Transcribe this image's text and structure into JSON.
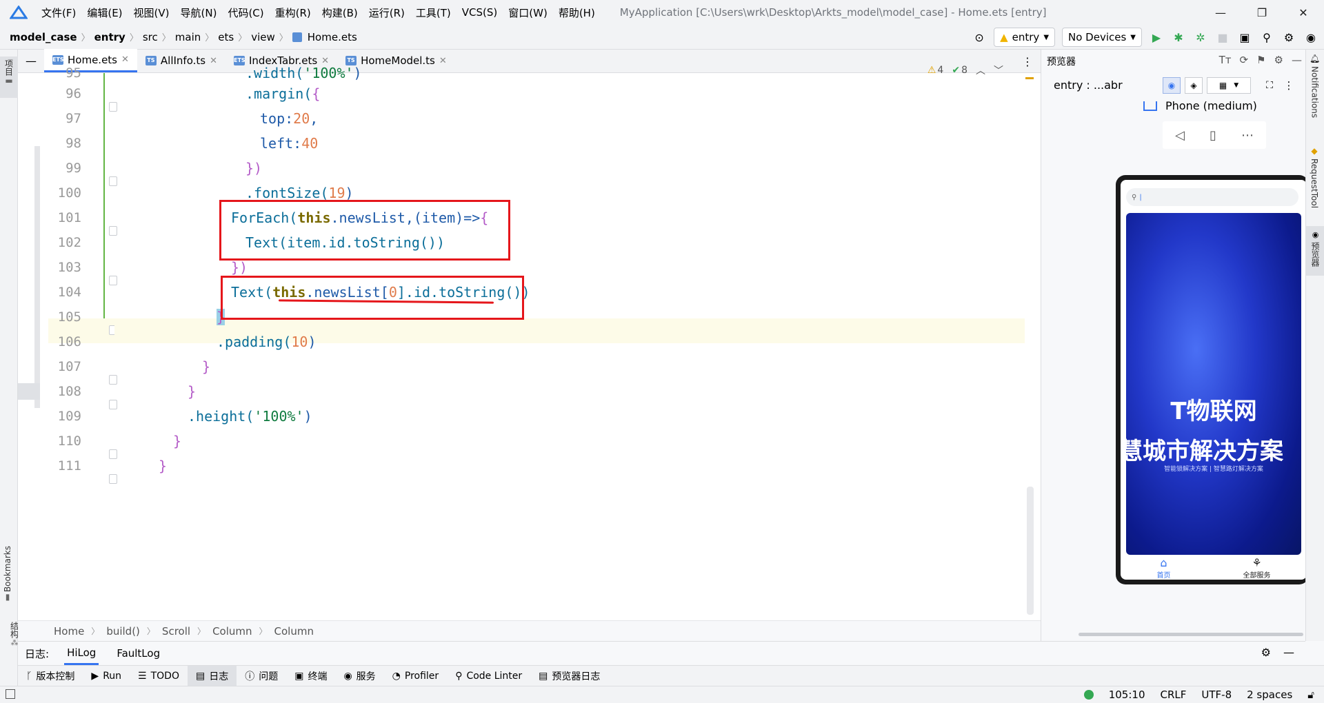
{
  "titlebar": {
    "menus": [
      "文件(F)",
      "编辑(E)",
      "视图(V)",
      "导航(N)",
      "代码(C)",
      "重构(R)",
      "构建(B)",
      "运行(R)",
      "工具(T)",
      "VCS(S)",
      "窗口(W)",
      "帮助(H)"
    ],
    "title": "MyApplication [C:\\Users\\wrk\\Desktop\\Arkts_model\\model_case] - Home.ets [entry]"
  },
  "navbar": {
    "crumbs": [
      "model_case",
      "entry",
      "src",
      "main",
      "ets",
      "view",
      "Home.ets"
    ],
    "module_select": "entry",
    "device_select": "No Devices"
  },
  "leftstrip": {
    "project": "项目",
    "bookmarks": "Bookmarks",
    "structure": "结构"
  },
  "tabs": [
    "Home.ets",
    "AllInfo.ts",
    "IndexTabr.ets",
    "HomeModel.ts"
  ],
  "editor": {
    "line_numbers": [
      "95",
      "96",
      "97",
      "98",
      "99",
      "100",
      "101",
      "102",
      "103",
      "104",
      "105",
      "106",
      "107",
      "108",
      "109",
      "110",
      "111"
    ],
    "warnings": "4",
    "checks": "8",
    "breadcrumb": [
      "Home",
      "build()",
      "Scroll",
      "Column",
      "Column"
    ]
  },
  "code": {
    "l95": [
      ".width(",
      "'100%'",
      ")"
    ],
    "l96": [
      ".margin(",
      "{"
    ],
    "l97": [
      "top:",
      "20",
      ","
    ],
    "l98": [
      "left:",
      "40"
    ],
    "l99": [
      "})"
    ],
    "l100": [
      ".fontSize(",
      "19",
      ")"
    ],
    "l101": [
      "ForEach(",
      "this",
      ".newsList,(item)=>",
      "{"
    ],
    "l102": [
      "Text(item.id.toString())"
    ],
    "l103": [
      "})"
    ],
    "l104": [
      "Text(",
      "this",
      ".newsList[",
      "0",
      "].id.toString())"
    ],
    "l105": [
      "}"
    ],
    "l106": [
      ".padding(",
      "10",
      ")"
    ],
    "l107": [
      "}"
    ],
    "l108": [
      "}"
    ],
    "l109": [
      ".height(",
      "'100%'",
      ")"
    ],
    "l110": [
      "}"
    ],
    "l111": [
      "}"
    ]
  },
  "preview": {
    "title": "预览器",
    "entry_label": "entry : ...abr",
    "device_name": "Phone (medium)",
    "banner_line1": "T物联网",
    "banner_line2": "慧城市解决方案",
    "banner_line3": "智能锁解决方案 | 智慧路灯解决方案",
    "nav_home": "首页",
    "nav_all": "全部服务"
  },
  "rightstrip": {
    "notifications": "Notifications",
    "requesttool": "RequestTool",
    "previewer": "预览器"
  },
  "logpanel": {
    "label": "日志:",
    "tabs": [
      "HiLog",
      "FaultLog"
    ]
  },
  "toolbar": {
    "items": [
      "版本控制",
      "Run",
      "TODO",
      "日志",
      "问题",
      "终端",
      "服务",
      "Profiler",
      "Code Linter",
      "预览器日志"
    ]
  },
  "status": {
    "position": "105:10",
    "line_sep": "CRLF",
    "encoding": "UTF-8",
    "indent": "2 spaces"
  },
  "colors": {
    "accent": "#3574f0",
    "annotation": "#e5161b",
    "run": "#34a853"
  }
}
